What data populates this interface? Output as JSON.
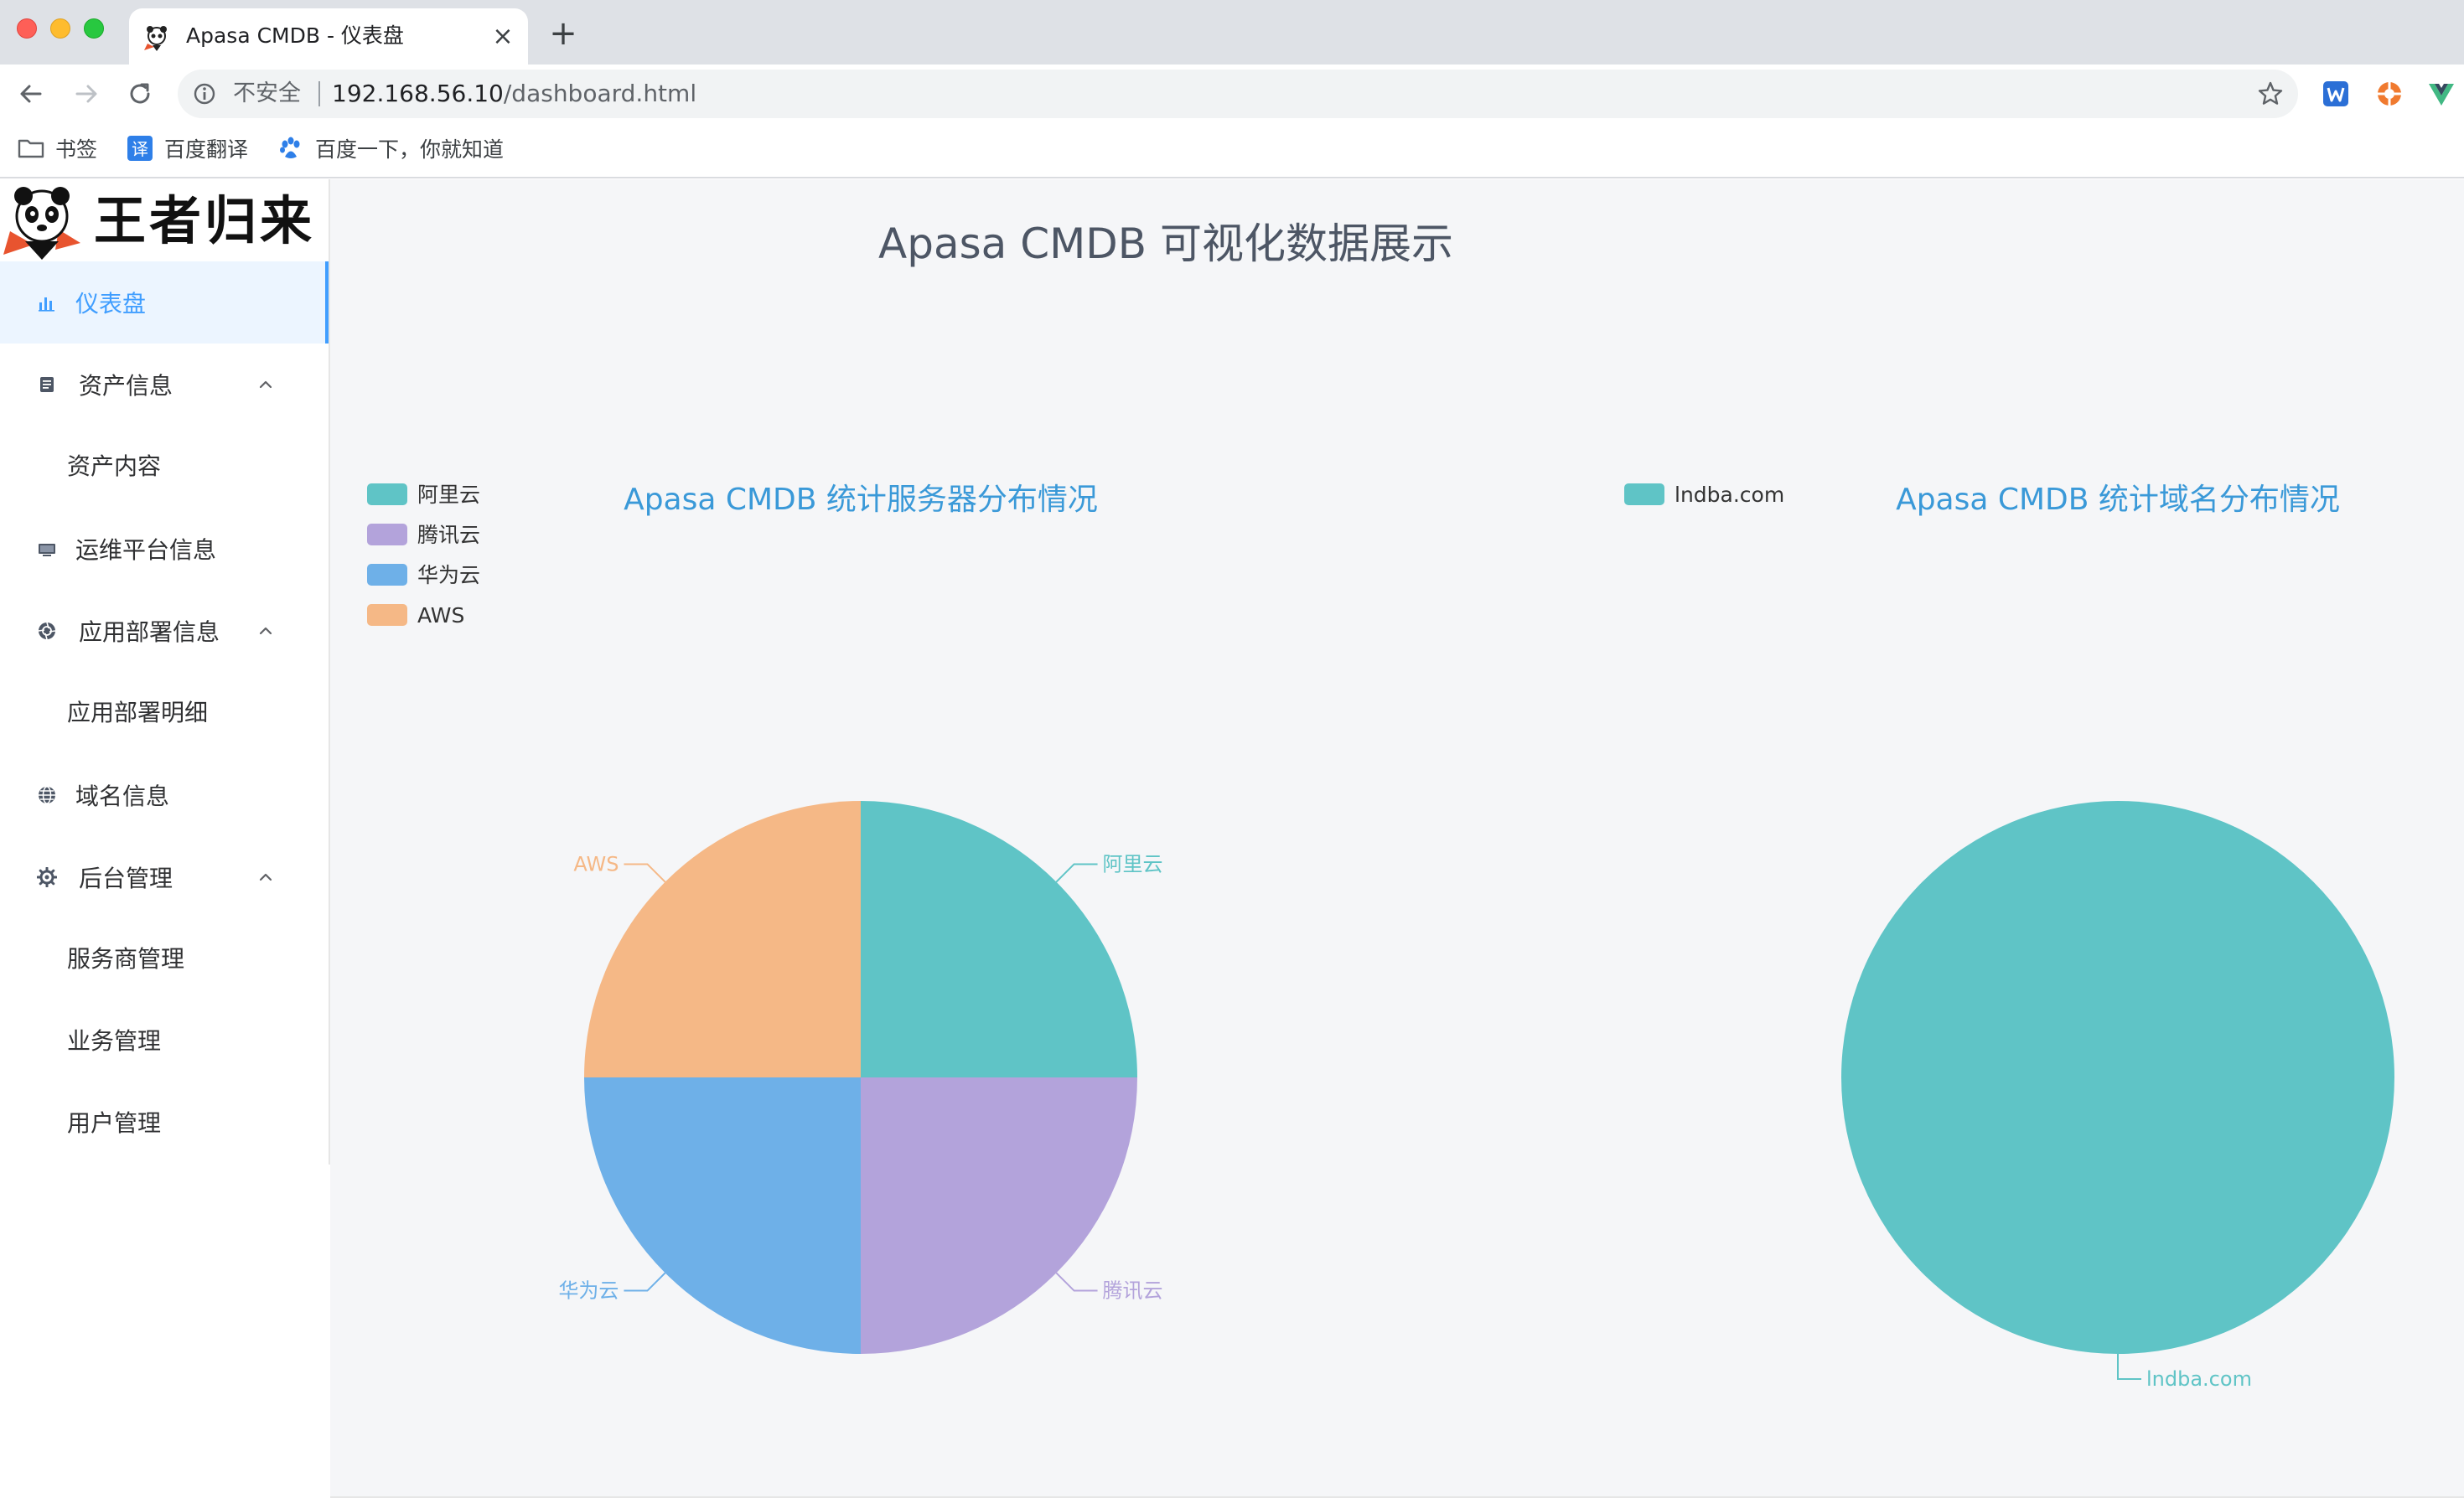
{
  "browser": {
    "tab_title": "Apasa CMDB - 仪表盘",
    "tab_close": "×",
    "new_tab": "+",
    "security_label": "不安全",
    "url_host": "192.168.56.10",
    "url_path": "/dashboard.html",
    "bookmarks": [
      {
        "label": "书签",
        "icon": "folder-icon"
      },
      {
        "label": "百度翻译",
        "icon": "translate-icon"
      },
      {
        "label": "百度一下，你就知道",
        "icon": "baidu-paw-icon"
      }
    ],
    "extensions": [
      "w-extension-icon",
      "orange-extension-icon",
      "vue-extension-icon"
    ]
  },
  "sidebar": {
    "logo_text": "王者归来",
    "items": [
      {
        "label": "仪表盘",
        "icon": "bar-chart-icon",
        "active": true
      },
      {
        "label": "资产信息",
        "icon": "document-icon",
        "expanded": true
      },
      {
        "label": "资产内容",
        "sub": true
      },
      {
        "label": "运维平台信息",
        "icon": "monitor-icon"
      },
      {
        "label": "应用部署信息",
        "icon": "aperture-icon",
        "expanded": true
      },
      {
        "label": "应用部署明细",
        "sub": true
      },
      {
        "label": "域名信息",
        "icon": "globe-icon"
      },
      {
        "label": "后台管理",
        "icon": "gear-icon",
        "expanded": true
      },
      {
        "label": "服务商管理",
        "sub": true
      },
      {
        "label": "业务管理",
        "sub": true
      },
      {
        "label": "用户管理",
        "sub": true
      }
    ]
  },
  "main": {
    "title": "Apasa CMDB 可视化数据展示"
  },
  "colors": {
    "teal": "#5fc4c6",
    "purple": "#b3a3db",
    "blue": "#6eb0e8",
    "orange": "#f5b886",
    "title_blue": "#3a99d8",
    "active_blue": "#409eff"
  },
  "chart_data": [
    {
      "type": "pie",
      "title": "Apasa CMDB 统计服务器分布情况",
      "legend_position": "top-left",
      "categories": [
        "阿里云",
        "腾讯云",
        "华为云",
        "AWS"
      ],
      "values": [
        1,
        1,
        1,
        1
      ],
      "colors": [
        "#5fc4c6",
        "#b3a3db",
        "#6eb0e8",
        "#f5b886"
      ]
    },
    {
      "type": "pie",
      "title": "Apasa CMDB 统计域名分布情况",
      "legend_position": "top-left",
      "categories": [
        "lndba.com"
      ],
      "values": [
        1
      ],
      "colors": [
        "#5fc4c6"
      ]
    }
  ]
}
